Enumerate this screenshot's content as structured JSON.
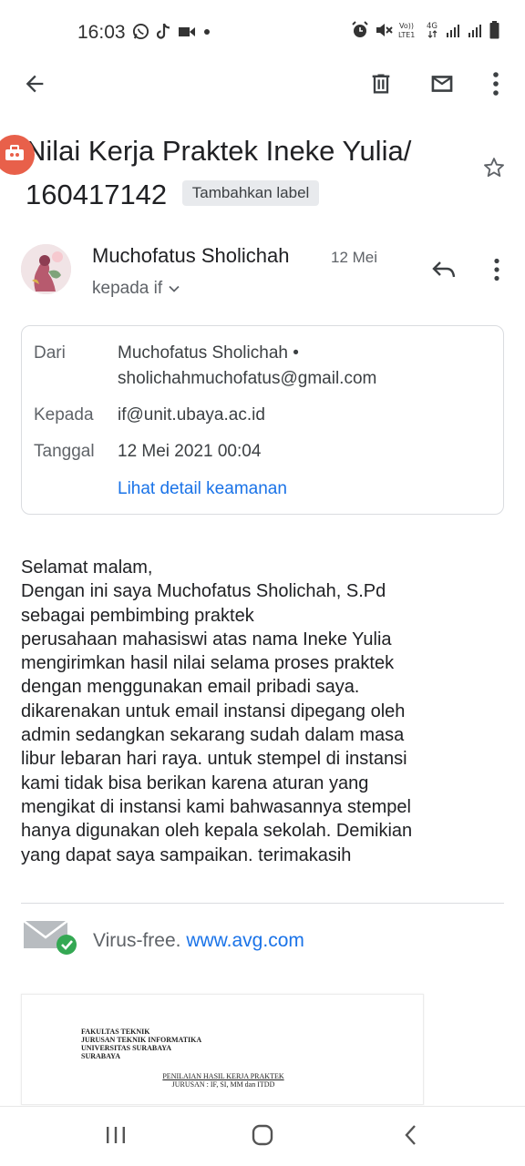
{
  "status_bar": {
    "time": "16:03",
    "left_icons": [
      "whatsapp-icon",
      "tiktok-icon",
      "video-icon",
      "dot-icon"
    ],
    "right_icons": [
      "alarm-icon",
      "mute-icon",
      "volte-icon",
      "signal-icon",
      "battery-icon"
    ],
    "volte_label": "Vo)) LTE1",
    "network_label": "4G"
  },
  "toolbar": {
    "icons": [
      "back-arrow-icon",
      "delete-icon",
      "mail-icon",
      "more-vert-icon"
    ]
  },
  "email": {
    "subject": "Nilai Kerja Praktek Ineke Yulia/ 160417142",
    "label_chip": "Tambahkan label",
    "sender_name": "Muchofatus Sholichah",
    "date_short": "12 Mei",
    "recipient_line": "kepada if",
    "details": {
      "from_label": "Dari",
      "from_name": "Muchofatus Sholichah •",
      "from_email": "sholichahmuchofatus@gmail.com",
      "to_label": "Kepada",
      "to_value": "if@unit.ubaya.ac.id",
      "date_label": "Tanggal",
      "date_value": "12 Mei 2021 00:04",
      "security_link": "Lihat detail keamanan"
    },
    "body_lines": [
      "Selamat malam,",
      "Dengan ini saya Muchofatus Sholichah, S.Pd",
      "sebagai pembimbing praktek",
      "perusahaan mahasiswi atas nama Ineke Yulia",
      "mengirimkan hasil nilai selama proses praktek",
      "dengan menggunakan email pribadi saya.",
      "dikarenakan untuk email instansi dipegang oleh",
      "admin sedangkan sekarang sudah dalam masa",
      "libur lebaran hari raya. untuk stempel di instansi",
      "kami tidak bisa berikan karena aturan yang",
      "mengikat di instansi kami bahwasannya stempel",
      "hanya digunakan oleh kepala sekolah. Demikian",
      "yang dapat saya sampaikan. terimakasih"
    ],
    "virus_text": "Virus-free.",
    "virus_link": "www.avg.com"
  },
  "attachment": {
    "header_lines": [
      "FAKULTAS TEKNIK",
      "JURUSAN TEKNIK INFORMATIKA",
      "UNIVERSITAS SURABAYA",
      "SURABAYA"
    ],
    "title": "PENILAIAN HASIL KERJA PRAKTEK",
    "subtitle": "JURUSAN : IF, SI, MM dan ITDD"
  },
  "nav_bar": {
    "icons": [
      "recent-apps-icon",
      "home-icon",
      "back-icon"
    ]
  },
  "colors": {
    "link": "#1a73e8",
    "secondary_text": "#5f6368",
    "record_badge": "#e8604a",
    "check_green": "#34a853"
  }
}
